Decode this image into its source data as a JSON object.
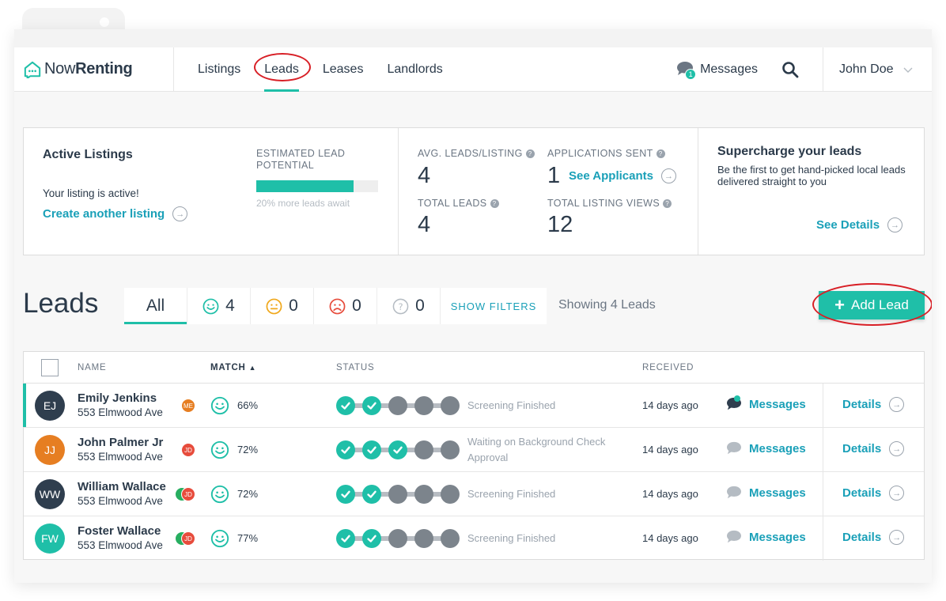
{
  "brand": {
    "name_part1": "Now",
    "name_part2": "Renting",
    "accent": "#1fbfa8"
  },
  "nav": {
    "links": [
      {
        "label": "Listings",
        "active": false
      },
      {
        "label": "Leads",
        "active": true
      },
      {
        "label": "Leases",
        "active": false
      },
      {
        "label": "Landlords",
        "active": false
      }
    ],
    "messages_label": "Messages",
    "messages_badge": "1",
    "user_name": "John Doe"
  },
  "active_listings": {
    "title": "Active Listings",
    "status": "Your listing is active!",
    "create_link": "Create another listing",
    "potential_label": "ESTIMATED LEAD POTENTIAL",
    "potential_fraction": 0.8,
    "potential_hint": "20% more leads await"
  },
  "metrics": {
    "avg_leads_label": "AVG. LEADS/LISTING",
    "avg_leads_value": "4",
    "apps_sent_label": "APPLICATIONS SENT",
    "apps_sent_value": "1",
    "see_applicants": "See Applicants",
    "total_leads_label": "TOTAL LEADS",
    "total_leads_value": "4",
    "total_views_label": "TOTAL LISTING VIEWS",
    "total_views_value": "12"
  },
  "promo": {
    "title": "Supercharge your leads",
    "text": "Be the first to get hand-picked local leads delivered straight to you",
    "link": "See Details"
  },
  "leads": {
    "heading": "Leads",
    "filters": {
      "all": "All",
      "happy": "4",
      "neutral": "0",
      "sad": "0",
      "unknown": "0",
      "show_filters": "SHOW FILTERS"
    },
    "showing": "Showing 4 Leads",
    "add_button": "Add Lead",
    "columns": {
      "name": "NAME",
      "match": "MATCH",
      "status": "STATUS",
      "received": "RECEIVED"
    },
    "rows": [
      {
        "initials": "EJ",
        "avatar_color": "#2f3e4e",
        "name": "Emily Jenkins",
        "address": "553 Elmwood Ave",
        "badges": [
          {
            "text": "ME",
            "color": "#e67e22"
          }
        ],
        "match": "66%",
        "steps_done": 2,
        "status": "Screening Finished",
        "received": "14 days ago",
        "messages": "Messages",
        "details": "Details",
        "unread": true,
        "selected": true
      },
      {
        "initials": "JJ",
        "avatar_color": "#e67e22",
        "name": "John Palmer Jr",
        "address": "553 Elmwood Ave",
        "badges": [
          {
            "text": "JD",
            "color": "#e74c3c"
          }
        ],
        "match": "72%",
        "steps_done": 3,
        "status": "Waiting on Background Check Approval",
        "received": "14 days ago",
        "messages": "Messages",
        "details": "Details",
        "unread": false,
        "selected": false
      },
      {
        "initials": "WW",
        "avatar_color": "#2f3e4e",
        "name": "William Wallace",
        "address": "553 Elmwood Ave",
        "badges": [
          {
            "text": "",
            "color": "#27ae60"
          },
          {
            "text": "JD",
            "color": "#e74c3c"
          }
        ],
        "match": "72%",
        "steps_done": 2,
        "status": "Screening Finished",
        "received": "14 days ago",
        "messages": "Messages",
        "details": "Details",
        "unread": false,
        "selected": false
      },
      {
        "initials": "FW",
        "avatar_color": "#1fbfa8",
        "name": "Foster Wallace",
        "address": "553 Elmwood Ave",
        "badges": [
          {
            "text": "",
            "color": "#27ae60"
          },
          {
            "text": "JD",
            "color": "#e74c3c"
          }
        ],
        "match": "77%",
        "steps_done": 2,
        "status": "Screening Finished",
        "received": "14 days ago",
        "messages": "Messages",
        "details": "Details",
        "unread": false,
        "selected": false
      }
    ]
  }
}
